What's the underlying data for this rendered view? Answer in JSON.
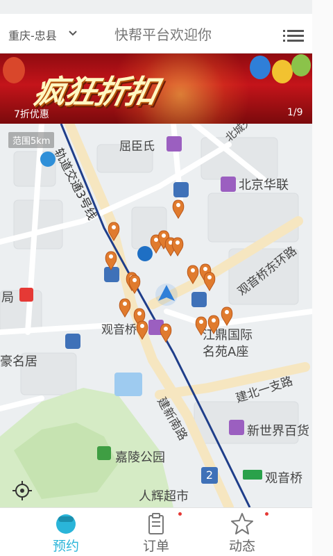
{
  "header": {
    "city": "重庆-忠县",
    "title": "快帮平台欢迎你",
    "menu_icon": "menu-icon"
  },
  "banner": {
    "headline": "疯狂折扣",
    "caption": "7折优惠",
    "page_indicator": "1/9"
  },
  "map": {
    "range_label": "范围5km",
    "labels": [
      "屈臣氏",
      "北城天",
      "北京华联",
      "轨道交通3号线",
      "观音桥东环路",
      "局",
      "观音桥",
      "豪名居",
      "江鼎国际",
      "名苑A座",
      "建北一支路",
      "建新南路",
      "新世界百货",
      "嘉陵公园",
      "观音桥",
      "人辉超市",
      "嘉陵",
      "路"
    ]
  },
  "tabs": [
    {
      "label": "预约",
      "icon": "user-icon",
      "active": true
    },
    {
      "label": "订单",
      "icon": "clipboard-icon",
      "active": false
    },
    {
      "label": "动态",
      "icon": "star-icon",
      "active": false
    }
  ],
  "colors": {
    "accent": "#2ab5d9",
    "pin": "#e07b2e",
    "rail": "#1f3e8a",
    "road": "#f7e9c6",
    "badge": "#e53935"
  }
}
